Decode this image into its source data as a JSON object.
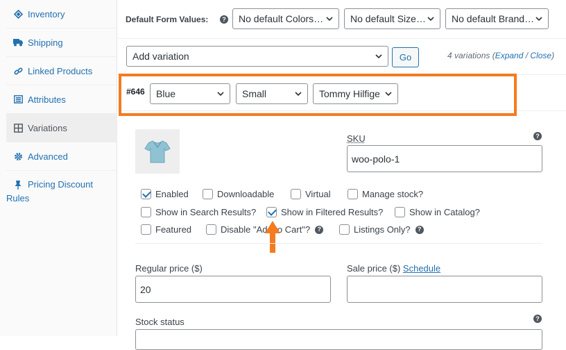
{
  "sidebar": {
    "items": [
      {
        "label": "Inventory",
        "icon": "inventory-icon"
      },
      {
        "label": "Shipping",
        "icon": "truck-icon"
      },
      {
        "label": "Linked Products",
        "icon": "link-icon"
      },
      {
        "label": "Attributes",
        "icon": "list-icon"
      },
      {
        "label": "Variations",
        "icon": "grid-icon",
        "active": true
      },
      {
        "label": "Advanced",
        "icon": "gear-icon"
      },
      {
        "label_line1": "Pricing Discount",
        "label_line2": "Rules",
        "icon": "pin-icon"
      }
    ]
  },
  "defaults": {
    "label": "Default Form Values:",
    "colors": "No default Colors…",
    "sizes": "No default Size…",
    "brands": "No default Brand…"
  },
  "actions": {
    "select_value": "Add variation",
    "go_label": "Go",
    "count_text": "4 variations (",
    "expand": "Expand",
    "sep": " / ",
    "close": "Close",
    "close_paren": ")"
  },
  "variation": {
    "id": "#646",
    "color": "Blue",
    "size": "Small",
    "brand": "Tommy Hilfiger",
    "sku_label": "SKU",
    "sku_value": "woo-polo-1",
    "checkboxes": {
      "enabled": "Enabled",
      "downloadable": "Downloadable",
      "virtual": "Virtual",
      "manage_stock": "Manage stock?",
      "search_results": "Show in Search Results?",
      "filtered_results": "Show in Filtered Results?",
      "catalog": "Show in Catalog?",
      "featured": "Featured",
      "disable_cart": "Disable \"Add to Cart\"?",
      "listings_only": "Listings Only?"
    },
    "regular_price_label": "Regular price ($)",
    "regular_price": "20",
    "sale_price_label": "Sale price ($) ",
    "schedule": "Schedule",
    "stock_status_label": "Stock status"
  },
  "colors": {
    "accent": "#2271b1",
    "highlight": "#f47b20"
  }
}
